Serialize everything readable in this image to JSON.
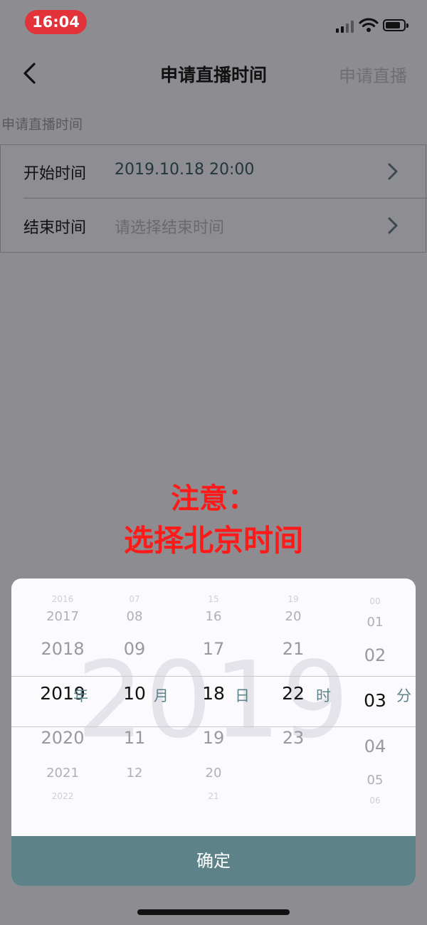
{
  "status_bar": {
    "time": "16:04"
  },
  "nav": {
    "title": "申请直播时间",
    "action": "申请直播"
  },
  "section_label": "申请直播时间",
  "form": {
    "start": {
      "label": "开始时间",
      "value": "2019.10.18 20:00"
    },
    "end": {
      "label": "结束时间",
      "placeholder": "请选择结束时间"
    }
  },
  "notice": {
    "line1": "注意：",
    "line2": "选择北京时间"
  },
  "picker": {
    "watermark": "2019",
    "year": {
      "items": [
        "2016",
        "2017",
        "2018",
        "2019",
        "2020",
        "2021",
        "2022"
      ],
      "unit": "年"
    },
    "month": {
      "items": [
        "07",
        "08",
        "09",
        "10",
        "11",
        "12"
      ],
      "unit": "月"
    },
    "day": {
      "items": [
        "15",
        "16",
        "17",
        "18",
        "19",
        "20",
        "21"
      ],
      "unit": "日"
    },
    "hour": {
      "items": [
        "19",
        "20",
        "21",
        "22",
        "23"
      ],
      "unit": "时"
    },
    "minute": {
      "items": [
        "00",
        "01",
        "02",
        "03",
        "04",
        "05",
        "06"
      ],
      "unit": "分"
    },
    "confirm_label": "确定"
  }
}
